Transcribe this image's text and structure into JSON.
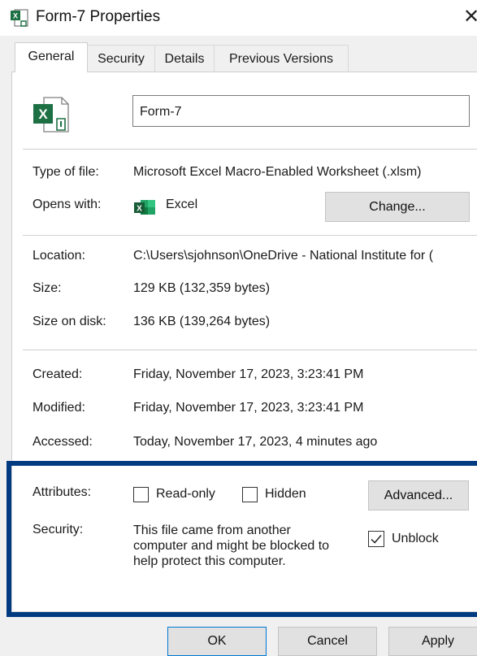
{
  "window": {
    "title": "Form-7 Properties",
    "icon": "excel-file-icon",
    "close_glyph": "✕"
  },
  "tabs": [
    {
      "label": "General",
      "active": true
    },
    {
      "label": "Security",
      "active": false
    },
    {
      "label": "Details",
      "active": false
    },
    {
      "label": "Previous Versions",
      "active": false
    }
  ],
  "general": {
    "file_name": "Form-7",
    "type_of_file": {
      "label": "Type of file:",
      "value": "Microsoft Excel Macro-Enabled Worksheet (.xlsm)"
    },
    "opens_with": {
      "label": "Opens with:",
      "app": "Excel",
      "change_button": "Change..."
    },
    "location": {
      "label": "Location:",
      "value": "C:\\Users\\sjohnson\\OneDrive - National Institute for ("
    },
    "size": {
      "label": "Size:",
      "value": "129 KB (132,359 bytes)"
    },
    "size_on_disk": {
      "label": "Size on disk:",
      "value": "136 KB (139,264 bytes)"
    },
    "created": {
      "label": "Created:",
      "value": "Friday, November 17, 2023, 3:23:41 PM"
    },
    "modified": {
      "label": "Modified:",
      "value": "Friday, November 17, 2023, 3:23:41 PM"
    },
    "accessed": {
      "label": "Accessed:",
      "value": "Today, November 17, 2023, 4 minutes ago"
    },
    "attributes": {
      "label": "Attributes:",
      "read_only": {
        "label": "Read-only",
        "checked": false
      },
      "hidden": {
        "label": "Hidden",
        "checked": false
      },
      "advanced_button": "Advanced..."
    },
    "security": {
      "label": "Security:",
      "message_lines": [
        "This file came from another",
        "computer and might be blocked to",
        "help protect this computer."
      ],
      "unblock": {
        "label": "Unblock",
        "checked": true
      }
    }
  },
  "footer": {
    "ok": "OK",
    "cancel": "Cancel",
    "apply": "Apply"
  },
  "colors": {
    "highlight_border": "#003a80",
    "excel_green": "#1d7044",
    "primary_button_border": "#0078d4"
  }
}
